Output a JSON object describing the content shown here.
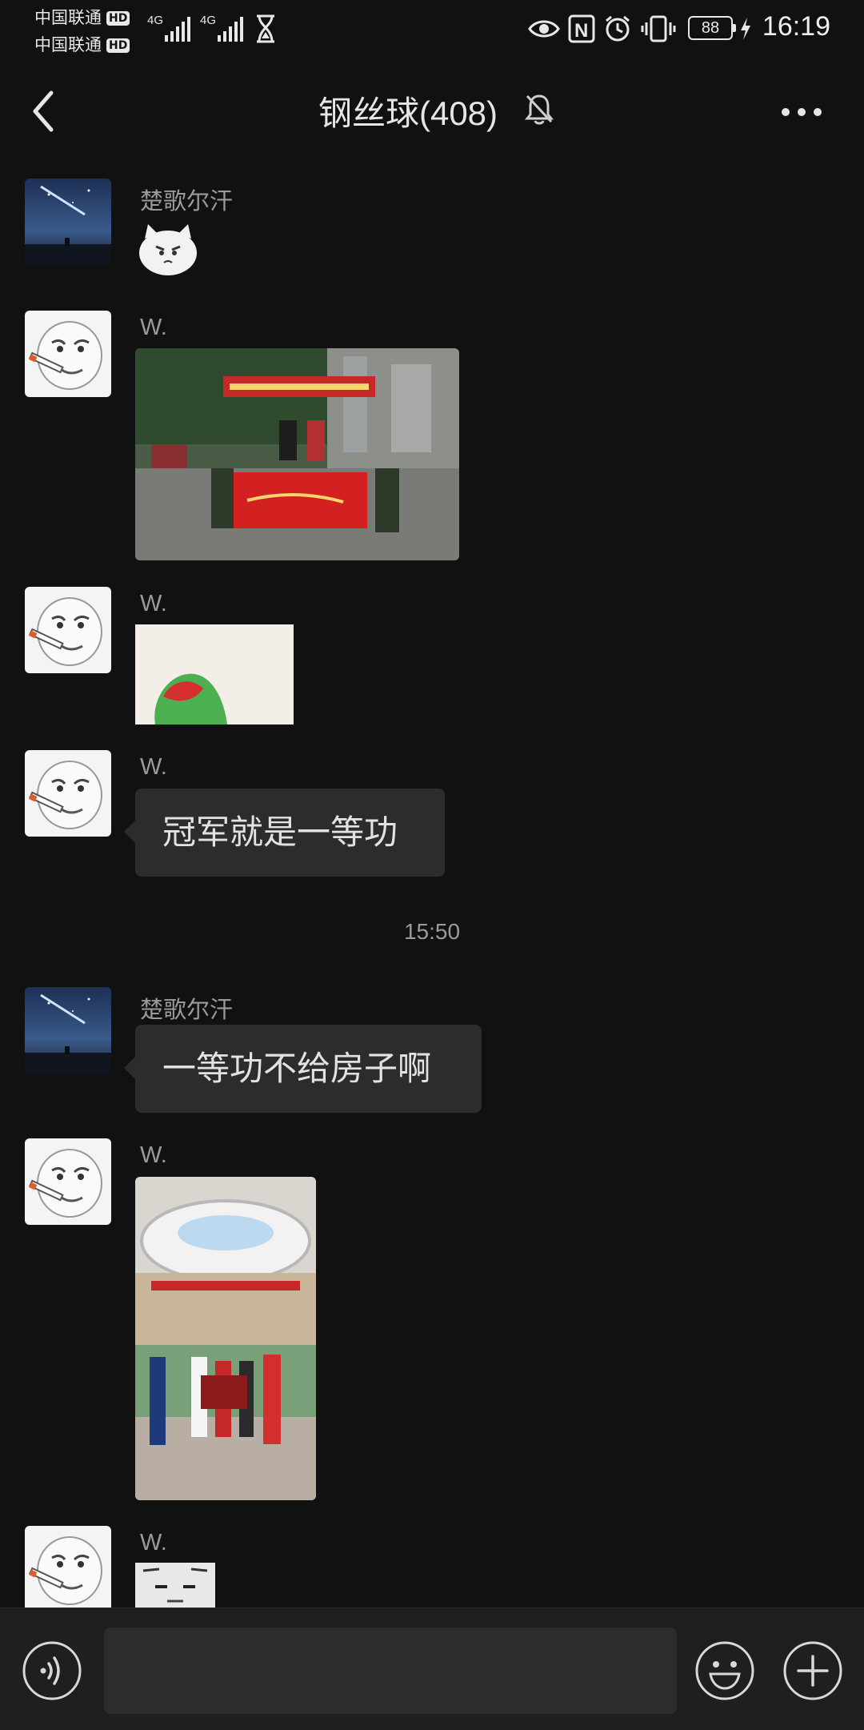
{
  "status_bar": {
    "carrier1": "中国联通",
    "carrier2": "中国联通",
    "hd_badge": "HD",
    "network1": "4G",
    "network2": "4G",
    "battery": "88",
    "time": "16:19"
  },
  "header": {
    "title": "钢丝球(408)",
    "back_icon": "chevron-left-icon",
    "mute_icon": "bell-off-icon",
    "more_icon": "more-dots-icon"
  },
  "messages": [
    {
      "sender": "楚歌尔汗",
      "type": "sticker",
      "content": "white cat sticker"
    },
    {
      "sender": "W.",
      "type": "image",
      "content": "photo"
    },
    {
      "sender": "W.",
      "type": "image",
      "content": "frog sticker"
    },
    {
      "sender": "W.",
      "type": "text",
      "content": "冠军就是一等功"
    },
    {
      "type": "timestamp",
      "content": "15:50"
    },
    {
      "sender": "楚歌尔汗",
      "type": "text",
      "content": "一等功不给房子啊"
    },
    {
      "sender": "W.",
      "type": "image",
      "content": "photo"
    },
    {
      "sender": "W.",
      "type": "sticker",
      "content": "sticker"
    }
  ],
  "input_bar": {
    "voice_icon": "voice-icon",
    "emoji_icon": "emoji-icon",
    "plus_icon": "plus-icon",
    "input_value": ""
  },
  "colors": {
    "background": "#111111",
    "bubble": "#2c2c2c",
    "input_bar": "#1f1f1f",
    "text": "#e2e2e2",
    "muted": "#9a9a9a"
  }
}
